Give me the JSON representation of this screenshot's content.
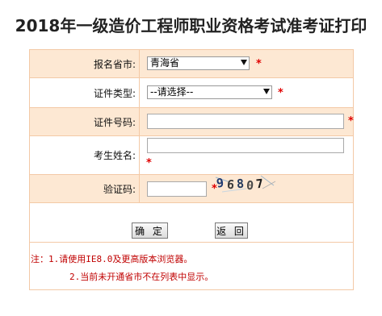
{
  "page": {
    "title": "2018年一级造价工程师职业资格考试准考证打印"
  },
  "form": {
    "province": {
      "label": "报名省市:",
      "value": "青海省",
      "required_mark": "*"
    },
    "id_type": {
      "label": "证件类型:",
      "value": "--请选择--",
      "required_mark": "*"
    },
    "id_number": {
      "label": "证件号码:",
      "value": "",
      "required_mark": "*"
    },
    "name": {
      "label": "考生姓名:",
      "value": "",
      "required_mark": "*"
    },
    "captcha": {
      "label": "验证码:",
      "value": "",
      "required_mark": "*",
      "image_text": [
        "9",
        "6",
        "8",
        "0",
        "7"
      ]
    }
  },
  "buttons": {
    "confirm": "确 定",
    "back": "返 回"
  },
  "notes": {
    "line1": "注：1.请使用IE8.0及更高版本浏览器。",
    "line2": "2.当前未开通省市不在列表中显示。"
  },
  "colors": {
    "row_shade": "#fde8d3",
    "border": "#f3c9a6",
    "required": "#e00000",
    "note": "#c00000"
  }
}
